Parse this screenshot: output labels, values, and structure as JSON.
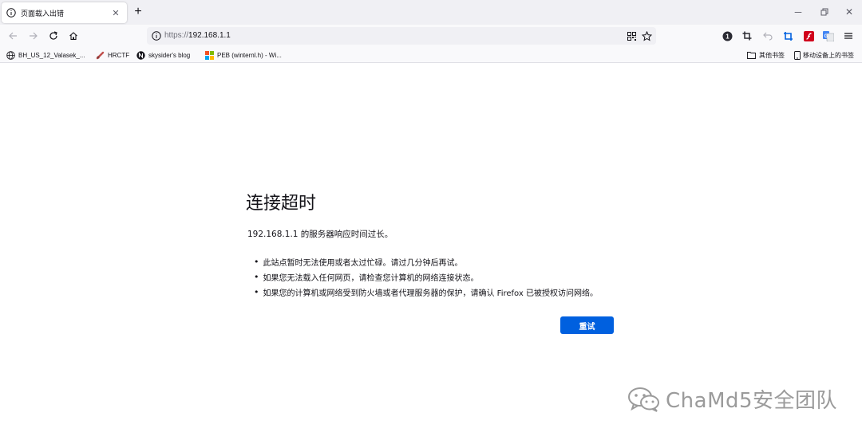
{
  "tab": {
    "title": "页面载入出错"
  },
  "window_buttons": [
    "minimize",
    "restore",
    "close"
  ],
  "urlbar": {
    "scheme": "https://",
    "host": "192.168.1.1"
  },
  "bookmarks": {
    "items": [
      {
        "label": "BH_US_12_Valasek_...",
        "icon": "globe-icon"
      },
      {
        "label": "HRCTF",
        "icon": "hrctf-icon"
      },
      {
        "label": "skysider's blog",
        "icon": "n-icon"
      },
      {
        "label": "PEB (winternl.h) - Wi...",
        "icon": "windows-icon"
      }
    ],
    "other_label": "其他书签",
    "mobile_label": "移动设备上的书签"
  },
  "error": {
    "title": "连接超时",
    "description": "192.168.1.1 的服务器响应时间过长。",
    "bullets": [
      "此站点暂时无法使用或者太过忙碌。请过几分钟后再试。",
      "如果您无法载入任何网页，请检查您计算机的网络连接状态。",
      "如果您的计算机或网络受到防火墙或者代理服务器的保护，请确认 Firefox 已被授权访问网络。"
    ],
    "retry_label": "重试"
  },
  "watermark": {
    "text": "ChaMd5安全团队"
  },
  "colors": {
    "accent": "#0060df",
    "tabbar": "#f0f0f4",
    "toolbar": "#f9f9fb"
  }
}
